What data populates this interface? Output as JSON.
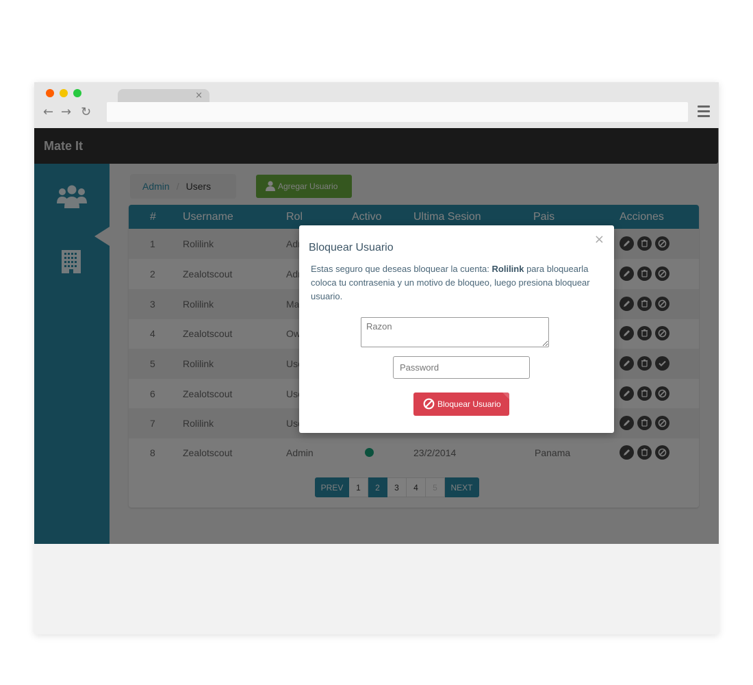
{
  "app": {
    "brand": "Mate It"
  },
  "breadcrumb": {
    "admin": "Admin",
    "users": "Users"
  },
  "toolbar": {
    "add_user_label": "Agregar Usuario"
  },
  "table": {
    "headers": {
      "num": "#",
      "username": "Username",
      "rol": "Rol",
      "activo": "Activo",
      "ultima_sesion": "Ultima Sesion",
      "pais": "Pais",
      "acciones": "Acciones"
    },
    "rows": [
      {
        "num": "1",
        "username": "Rolilink",
        "rol": "Admin",
        "ultima_sesion": "",
        "pais": ""
      },
      {
        "num": "2",
        "username": "Zealotscout",
        "rol": "Admin",
        "ultima_sesion": "",
        "pais": ""
      },
      {
        "num": "3",
        "username": "Rolilink",
        "rol": "Manager",
        "ultima_sesion": "",
        "pais": ""
      },
      {
        "num": "4",
        "username": "Zealotscout",
        "rol": "Owner",
        "ultima_sesion": "",
        "pais": ""
      },
      {
        "num": "5",
        "username": "Rolilink",
        "rol": "User",
        "ultima_sesion": "",
        "pais": ""
      },
      {
        "num": "6",
        "username": "Zealotscout",
        "rol": "User",
        "ultima_sesion": "",
        "pais": ""
      },
      {
        "num": "7",
        "username": "Rolilink",
        "rol": "User",
        "ultima_sesion": "",
        "pais": ""
      },
      {
        "num": "8",
        "username": "Zealotscout",
        "rol": "Admin",
        "ultima_sesion": "23/2/2014",
        "pais": "Panama"
      }
    ]
  },
  "pagination": {
    "prev": "PREV",
    "next": "NEXT",
    "pages": [
      "1",
      "2",
      "3",
      "4",
      "5"
    ],
    "current": "2"
  },
  "modal": {
    "title": "Bloquear Usuario",
    "text_before": "Estas seguro que deseas bloquear la cuenta: ",
    "account": "Rolilink",
    "text_after": " para bloquearla coloca tu contrasenia y un motivo de bloqueo, luego presiona bloquear usuario.",
    "razon_placeholder": "Razon",
    "password_placeholder": "Password",
    "submit_label": "Bloquear Usuario",
    "close": "×"
  },
  "colors": {
    "accent": "#2a8aa6",
    "topbar": "#333333",
    "success": "#6aae3f",
    "danger": "#d9414f",
    "status_active": "#17a27a"
  },
  "icons": {
    "sidebar": [
      "users-icon",
      "building-icon"
    ],
    "actions": [
      "edit-icon",
      "trash-icon",
      "block-icon"
    ]
  }
}
